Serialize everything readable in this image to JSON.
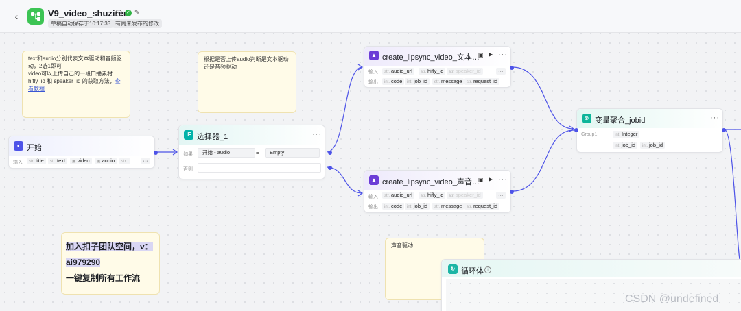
{
  "header": {
    "title": "V9_video_shuziren",
    "autosave": "草稿自动保存于10:17:33",
    "unpublished": "有尚未发布的修改"
  },
  "notes": {
    "top_left": {
      "line1": "text和audio分别代表文本驱动和音频驱动，2选1即可",
      "line2": "video可以上传自己的一段口播素材",
      "line3": "hifly_id 和 speaker_id 的获取方法，",
      "link": "查看教程"
    },
    "top_mid": "根据是否上传audio判断是文本驱动还是音频驱动",
    "promo": {
      "line1": "加入扣子团队空间，v：",
      "line2": "ai979290",
      "line3": "一键复制所有工作流"
    },
    "audio_drive": "声音驱动"
  },
  "nodes": {
    "start": {
      "title": "开始",
      "input_label": "输入",
      "vars": [
        {
          "type": "str.",
          "name": "title"
        },
        {
          "type": "str.",
          "name": "text"
        },
        {
          "type": "",
          "name": "video"
        },
        {
          "type": "",
          "name": "audio"
        },
        {
          "type": "str.",
          "name": ""
        }
      ],
      "more": "···"
    },
    "selector": {
      "title": "选择器_1",
      "if_label": "如果",
      "condition_left": "开始  -  audio",
      "operator": "=",
      "condition_right": "Empty",
      "else_label": "否则",
      "more": "···"
    },
    "lipsync_text": {
      "title": "create_lipsync_video_文本…",
      "input_label": "输入",
      "output_label": "输出",
      "inputs": [
        {
          "type": "str.",
          "name": "audio_url"
        },
        {
          "type": "str.",
          "name": "hifly_id"
        },
        {
          "type": "str.",
          "name": "speaker_id"
        }
      ],
      "outputs": [
        {
          "type": "int.",
          "name": "code"
        },
        {
          "type": "int.",
          "name": "job_id"
        },
        {
          "type": "str.",
          "name": "message"
        },
        {
          "type": "str.",
          "name": "request_id"
        }
      ],
      "more": "···"
    },
    "lipsync_audio": {
      "title": "create_lipsync_video_声音…",
      "input_label": "输入",
      "output_label": "输出",
      "inputs": [
        {
          "type": "str.",
          "name": "audio_url"
        },
        {
          "type": "str.",
          "name": "hifly_id"
        },
        {
          "type": "str.",
          "name": "speaker_id"
        }
      ],
      "outputs": [
        {
          "type": "int.",
          "name": "code"
        },
        {
          "type": "int.",
          "name": "job_id"
        },
        {
          "type": "str.",
          "name": "message"
        },
        {
          "type": "str.",
          "name": "request_id"
        }
      ],
      "more": "···"
    },
    "aggregate": {
      "title": "变量聚合_jobid",
      "group_label": "Group1",
      "type_chip": {
        "type": "int.",
        "name": "Integer"
      },
      "vars": [
        {
          "type": "int.",
          "name": "job_id"
        },
        {
          "type": "int.",
          "name": "job_id"
        }
      ],
      "more": "···"
    },
    "loop": {
      "title": "循环体"
    }
  },
  "watermark": "CSDN @undefined",
  "colors": {
    "accent": "#4d53e8",
    "start_icon": "#4d53e8",
    "selector_icon": "#00b2a9",
    "plugin_icon": "#6b3cd6",
    "aggregate_icon": "#0eb59a",
    "loop_icon": "#1cb5a5"
  }
}
